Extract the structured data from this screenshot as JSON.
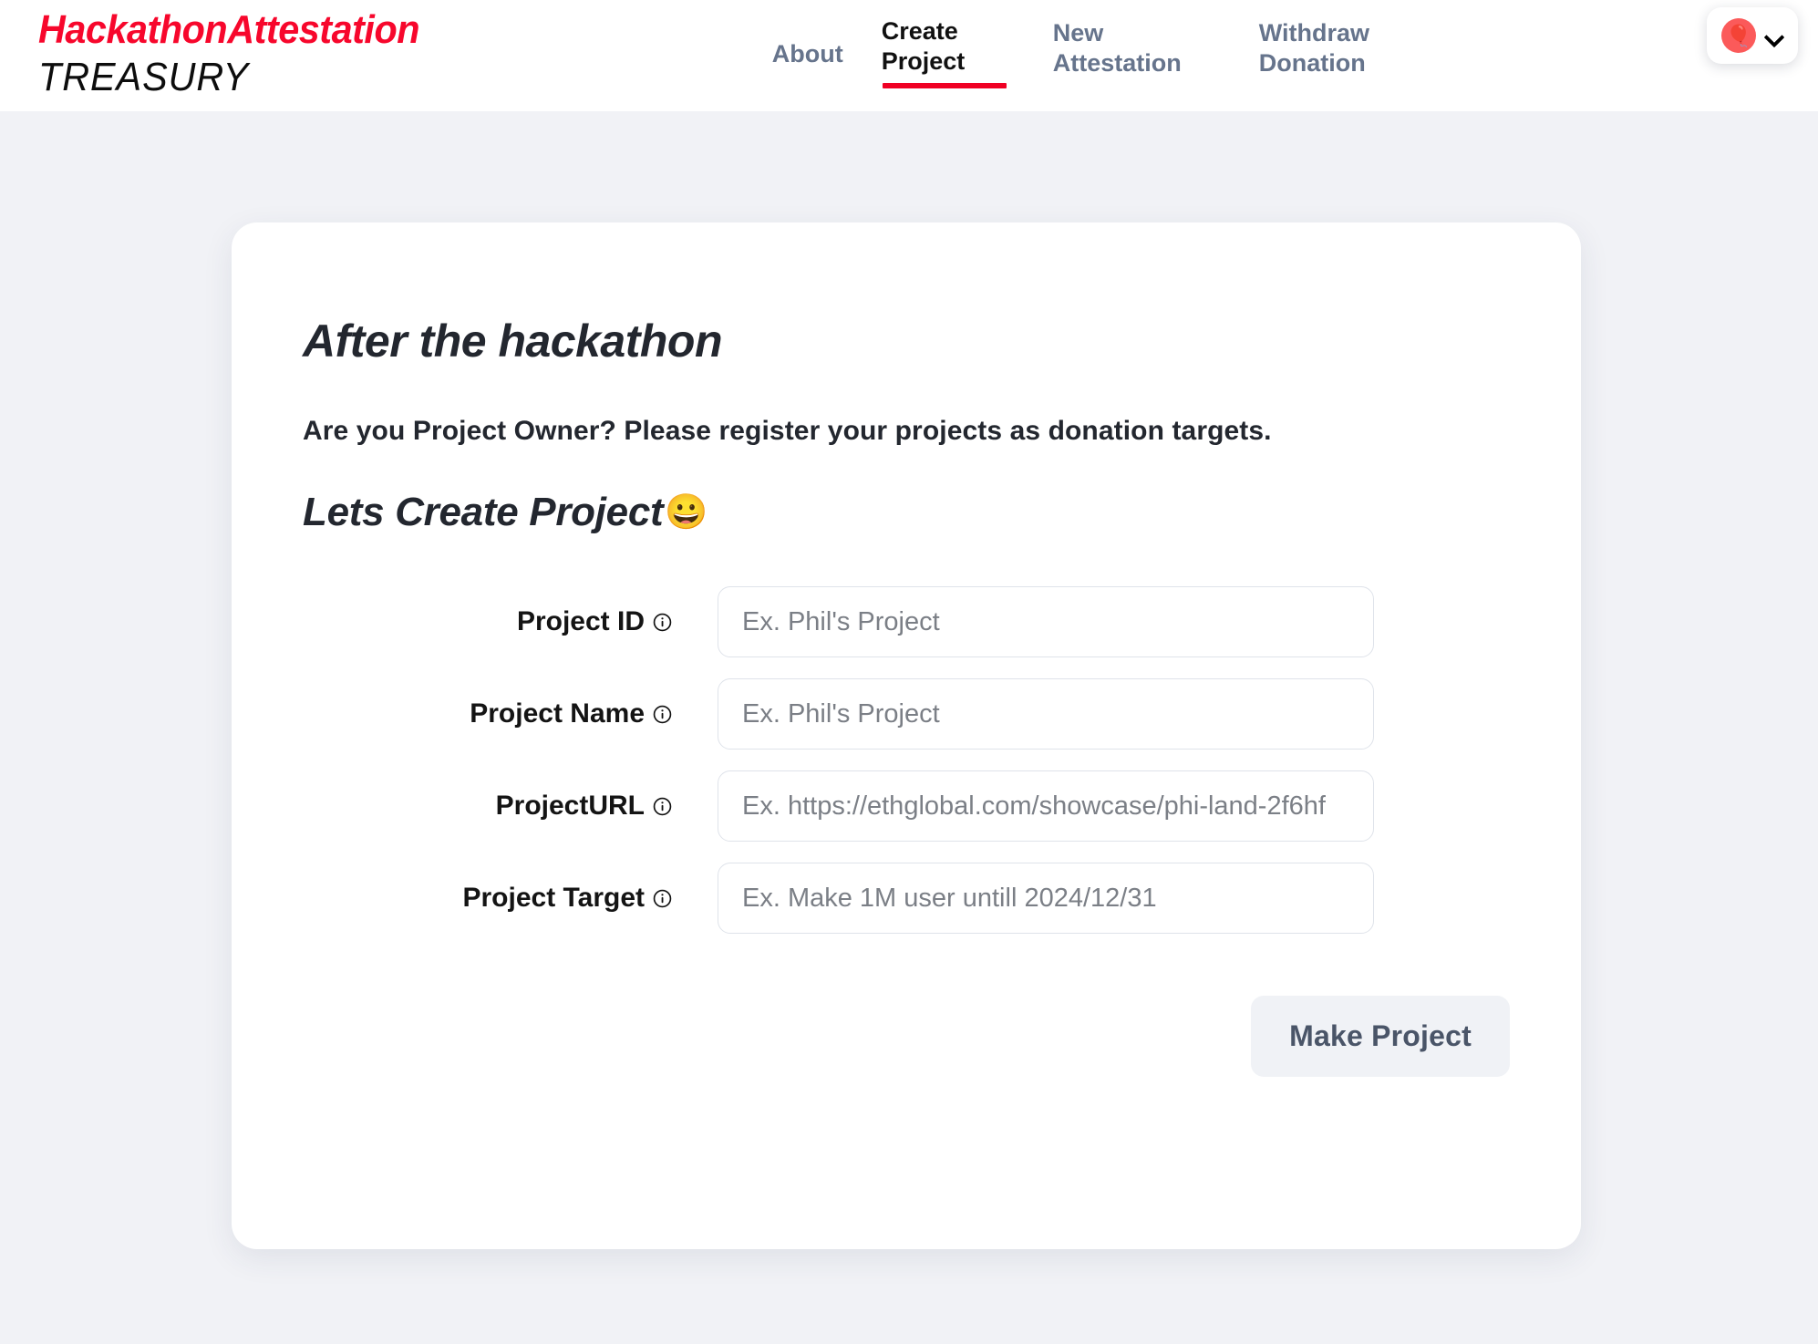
{
  "header": {
    "brand": {
      "line1": "HackathonAttestation",
      "line2": "TREASURY",
      "accent_color": "#f7072c"
    },
    "nav": [
      {
        "label": "About",
        "active": false
      },
      {
        "label": "Create Project",
        "active": true
      },
      {
        "label": "New Attestation",
        "active": false
      },
      {
        "label": "Withdraw Donation",
        "active": false
      }
    ],
    "account": {
      "avatar_emoji": "🎈",
      "chevron_icon": "chevron-down-icon"
    },
    "active_underline_color": "#f00024"
  },
  "card": {
    "title": "After the hackathon",
    "subtitle": "Are you Project Owner? Please register your projects as donation targets.",
    "section_heading": "Lets Create Project",
    "section_heading_emoji": "😀",
    "form": {
      "fields": [
        {
          "label": "Project ID",
          "info_icon": "info-circle-icon",
          "placeholder": "Ex. Phil's Project",
          "value": ""
        },
        {
          "label": "Project Name",
          "info_icon": "info-circle-icon",
          "placeholder": "Ex. Phil's Project",
          "value": ""
        },
        {
          "label": "ProjectURL",
          "info_icon": "info-circle-icon",
          "placeholder": "Ex. https://ethglobal.com/showcase/phi-land-2f6hf",
          "value": ""
        },
        {
          "label": "Project Target",
          "info_icon": "info-circle-icon",
          "placeholder": "Ex. Make 1M user untill 2024/12/31",
          "value": ""
        }
      ],
      "submit_label": "Make Project"
    }
  },
  "theme": {
    "page_background": "#f1f2f6",
    "card_background": "#ffffff",
    "button_background": "#f0f2f6",
    "button_text": "#4a5568"
  }
}
